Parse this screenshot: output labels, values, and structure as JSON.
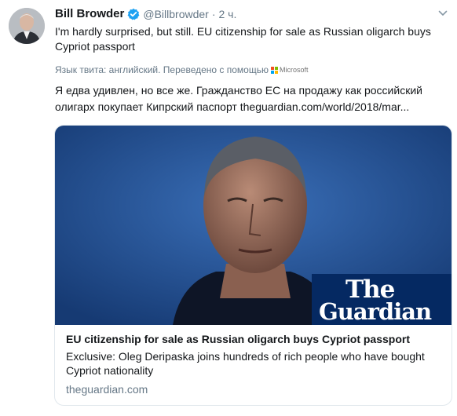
{
  "user": {
    "name": "Bill Browder",
    "handle": "@Billbrowder",
    "separator": "·",
    "time": "2 ч."
  },
  "tweet": {
    "text": "I'm hardly surprised, but still. EU citizenship for sale as Russian oligarch buys Cypriot passport",
    "translation_label": "Язык твита: английский. Переведено с помощью",
    "translator_brand": "Microsoft",
    "translated_text": "Я едва удивлен, но все же. Гражданство ЕС на продажу как российский олигарх покупает Кипрский паспорт",
    "translated_link": "theguardian.com/world/2018/mar..."
  },
  "card": {
    "logo_line1": "The",
    "logo_line2": "Guardian",
    "title": "EU citizenship for sale as Russian oligarch buys Cypriot passport",
    "description": "Exclusive: Oleg Deripaska joins hundreds of rich people who have bought Cypriot nationality",
    "domain": "theguardian.com"
  },
  "colors": {
    "verified": "#1da1f2",
    "guardian_blue": "#052962",
    "image_background": "#1f4f94",
    "muted_text": "#657786"
  },
  "icons": [
    "verified-badge-icon",
    "caret-down-icon",
    "microsoft-logo-icon"
  ]
}
